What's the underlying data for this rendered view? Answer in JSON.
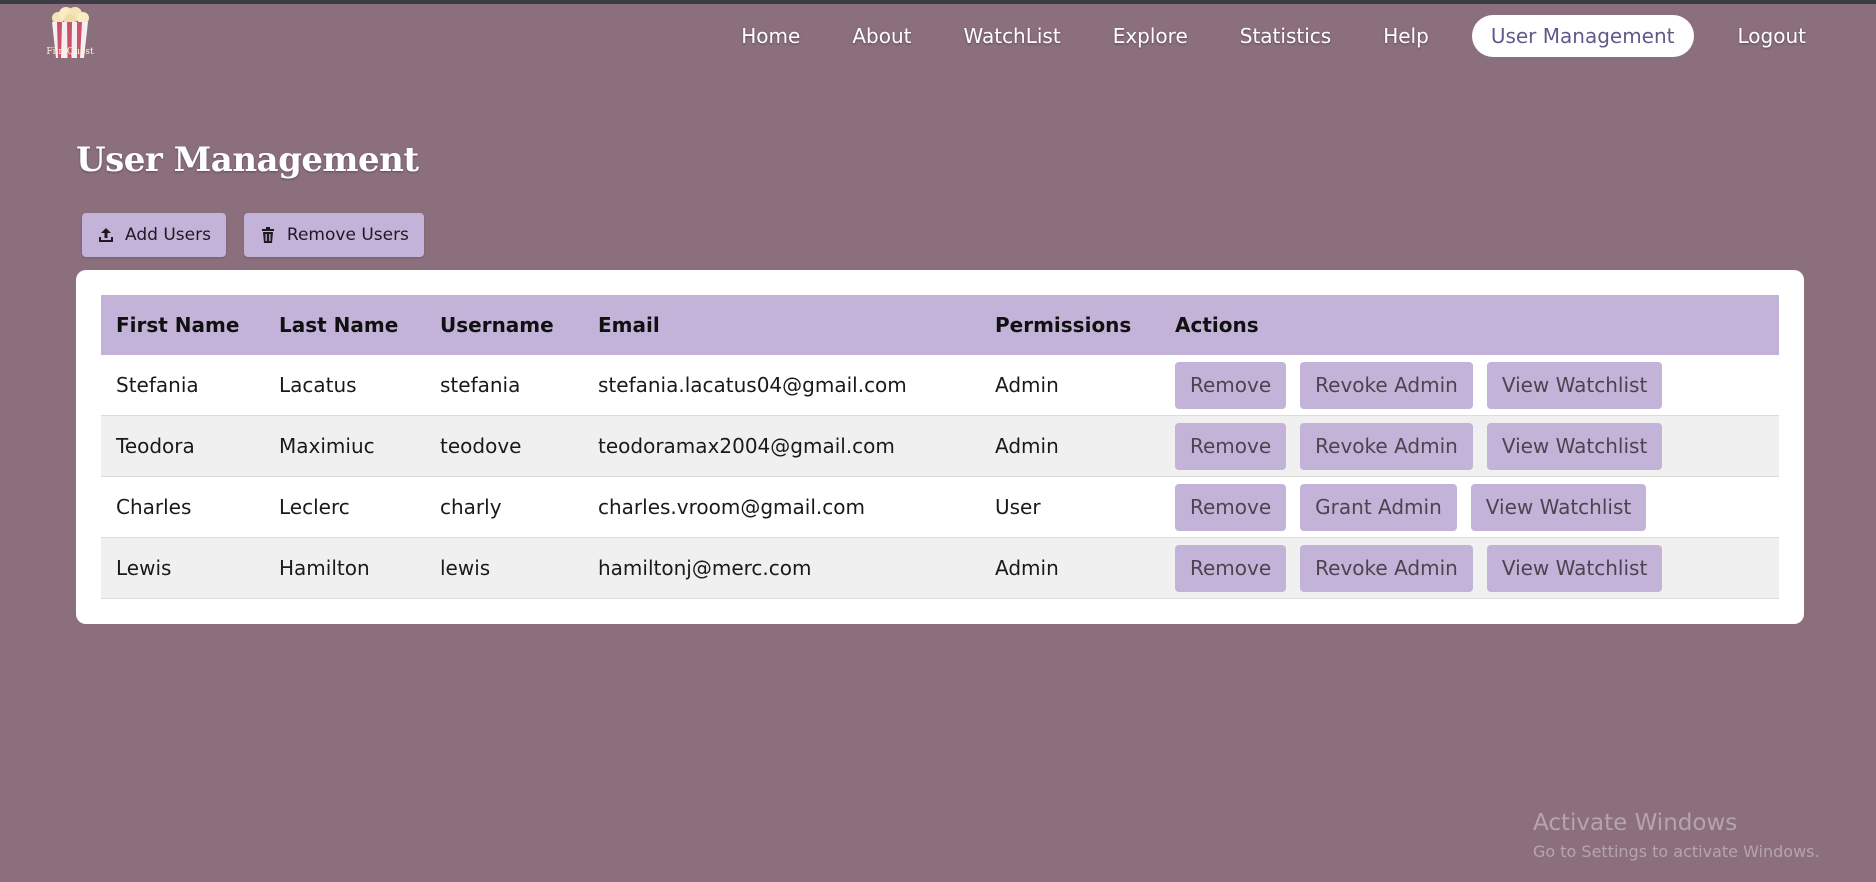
{
  "brand": {
    "logo_text": "FilmQuest"
  },
  "nav": {
    "items": [
      {
        "label": "Home"
      },
      {
        "label": "About"
      },
      {
        "label": "WatchList"
      },
      {
        "label": "Explore"
      },
      {
        "label": "Statistics"
      },
      {
        "label": "Help"
      },
      {
        "label": "User Management",
        "active": true
      },
      {
        "label": "Logout"
      }
    ]
  },
  "page": {
    "title": "User Management"
  },
  "toolbar": {
    "add_label": "Add Users",
    "add_icon": "upload-icon",
    "remove_label": "Remove Users",
    "remove_icon": "trash-icon"
  },
  "table": {
    "headers": [
      "First Name",
      "Last Name",
      "Username",
      "Email",
      "Permissions",
      "Actions"
    ],
    "rows": [
      {
        "first": "Stefania",
        "last": "Lacatus",
        "username": "stefania",
        "email": "stefania.lacatus04@gmail.com",
        "permission": "Admin",
        "actions": [
          "Remove",
          "Revoke Admin",
          "View Watchlist"
        ]
      },
      {
        "first": "Teodora",
        "last": "Maximiuc",
        "username": "teodove",
        "email": "teodoramax2004@gmail.com",
        "permission": "Admin",
        "actions": [
          "Remove",
          "Revoke Admin",
          "View Watchlist"
        ]
      },
      {
        "first": "Charles",
        "last": "Leclerc",
        "username": "charly",
        "email": "charles.vroom@gmail.com",
        "permission": "User",
        "actions": [
          "Remove",
          "Grant Admin",
          "View Watchlist"
        ]
      },
      {
        "first": "Lewis",
        "last": "Hamilton",
        "username": "lewis",
        "email": "hamiltonj@merc.com",
        "permission": "Admin",
        "actions": [
          "Remove",
          "Revoke Admin",
          "View Watchlist"
        ]
      }
    ]
  },
  "watermark": {
    "line1": "Activate Windows",
    "line2": "Go to Settings to activate Windows."
  },
  "colors": {
    "background": "#8b6f7d",
    "accent": "#c3b3d8",
    "nav_active_text": "#5f5a8c"
  }
}
